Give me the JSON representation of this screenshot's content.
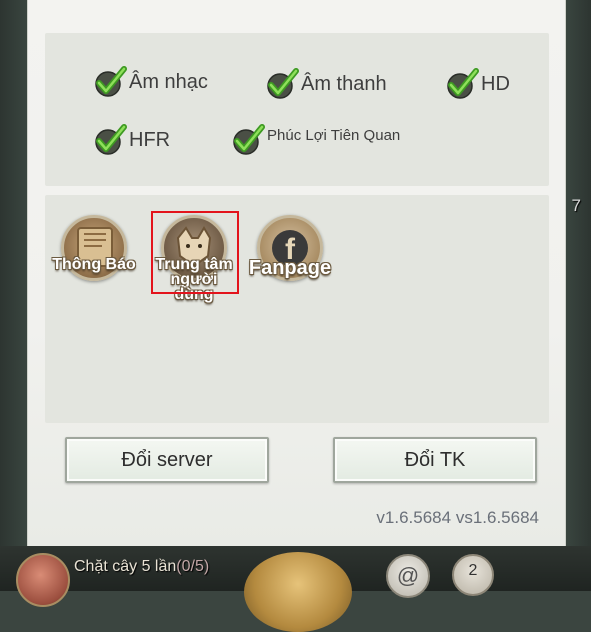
{
  "settings": {
    "options": [
      {
        "label": "Âm nhạc",
        "checked": true
      },
      {
        "label": "Âm thanh",
        "checked": true
      },
      {
        "label": "HD",
        "checked": true
      },
      {
        "label": "HFR",
        "checked": true
      },
      {
        "label": "Phúc Lợi Tiên Quan",
        "checked": true
      }
    ],
    "links": [
      {
        "label": "Thông Báo",
        "icon": "scroll-icon"
      },
      {
        "label": "Trung tâm người dùng",
        "icon": "fox-avatar-icon",
        "highlighted": true
      },
      {
        "label": "Fanpage",
        "icon": "facebook-icon"
      }
    ],
    "buttons": {
      "change_server": "Đổi server",
      "change_account": "Đổi TK"
    },
    "version": "v1.6.5684 vs1.6.5684"
  },
  "hud": {
    "quest_text": "Chặt cây 5 lần",
    "quest_progress": "(0/5)",
    "side_number": "7",
    "count_badge": "2"
  },
  "colors": {
    "check_green": "#4fae2f",
    "highlight_red": "#e3141c",
    "panel_bg": "#f1f1ee",
    "section_bg": "#e3e5df"
  }
}
